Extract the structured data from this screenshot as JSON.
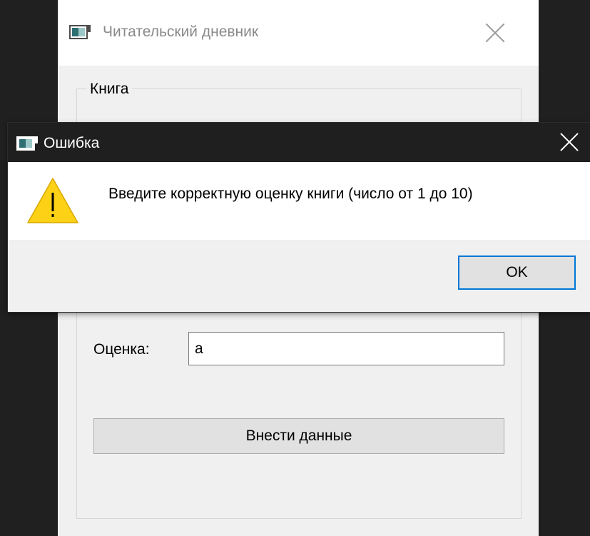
{
  "main_window": {
    "title": "Читательский дневник",
    "group_title": "Книга",
    "rating_label": "Оценка:",
    "rating_value": "а",
    "submit_label": "Внести данные"
  },
  "error_dialog": {
    "title": "Ошибка",
    "message": "Введите корректную оценку книги (число от 1 до 10)",
    "ok_label": "OK",
    "icon": "warning-icon"
  },
  "colors": {
    "desktop_background": "#202020",
    "dialog_titlebar": "#1f1f1f",
    "focus_accent": "#0078d7",
    "warning_yellow": "#fcd116"
  }
}
